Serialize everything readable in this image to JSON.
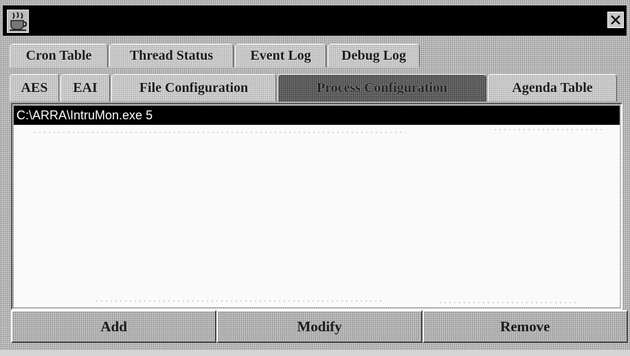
{
  "window": {
    "title": ""
  },
  "tabs_row1": [
    {
      "label": "Cron Table"
    },
    {
      "label": "Thread Status"
    },
    {
      "label": "Event Log"
    },
    {
      "label": "Debug Log"
    }
  ],
  "tabs_row2": [
    {
      "label": "AES"
    },
    {
      "label": "EAI"
    },
    {
      "label": "File Configuration"
    },
    {
      "label": "Process Configuration",
      "selected": true
    },
    {
      "label": "Agenda Table"
    }
  ],
  "process_list": {
    "items": [
      {
        "text": "C:\\ARRA\\IntruMon.exe 5",
        "selected": true
      }
    ]
  },
  "buttons": {
    "add": "Add",
    "modify": "Modify",
    "remove": "Remove"
  },
  "icons": {
    "app": "coffee-cup-icon",
    "close": "close-x-icon"
  }
}
